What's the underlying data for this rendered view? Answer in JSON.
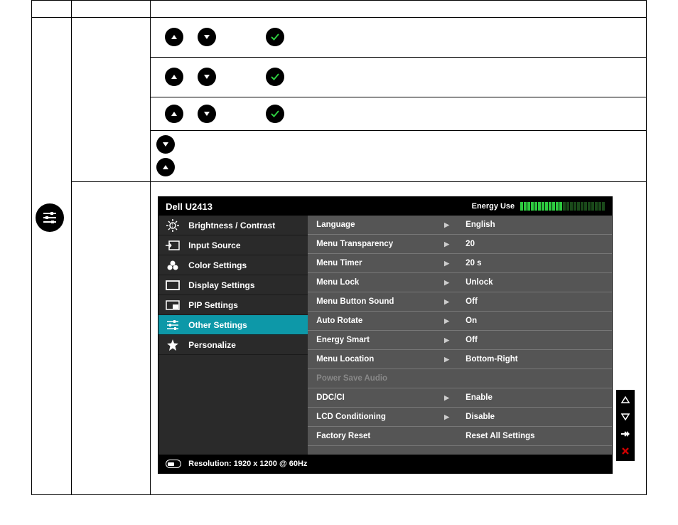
{
  "osd": {
    "title": "Dell U2413",
    "energy_label": "Energy Use",
    "energy_bars_total": 24,
    "energy_bars_on": 12,
    "menu": [
      {
        "icon": "brightness",
        "label": "Brightness / Contrast"
      },
      {
        "icon": "input",
        "label": "Input Source"
      },
      {
        "icon": "color",
        "label": "Color Settings"
      },
      {
        "icon": "display",
        "label": "Display Settings"
      },
      {
        "icon": "pip",
        "label": "PIP Settings"
      },
      {
        "icon": "other",
        "label": "Other Settings",
        "active": true
      },
      {
        "icon": "star",
        "label": "Personalize"
      }
    ],
    "settings": [
      {
        "name": "Language",
        "value": "English",
        "arrow": true
      },
      {
        "name": "Menu Transparency",
        "value": "20",
        "arrow": true
      },
      {
        "name": "Menu Timer",
        "value": "20 s",
        "arrow": true
      },
      {
        "name": "Menu Lock",
        "value": "Unlock",
        "arrow": true
      },
      {
        "name": "Menu Button Sound",
        "value": "Off",
        "arrow": true
      },
      {
        "name": "Auto Rotate",
        "value": "On",
        "arrow": true
      },
      {
        "name": "Energy Smart",
        "value": "Off",
        "arrow": true
      },
      {
        "name": "Menu Location",
        "value": "Bottom-Right",
        "arrow": true
      },
      {
        "name": "Power Save Audio",
        "value": "",
        "arrow": false,
        "disabled": true
      },
      {
        "name": "DDC/CI",
        "value": "Enable",
        "arrow": true
      },
      {
        "name": "LCD Conditioning",
        "value": "Disable",
        "arrow": true
      },
      {
        "name": "Factory Reset",
        "value": "Reset All Settings",
        "arrow": false
      }
    ],
    "footer": "Resolution: 1920 x 1200 @ 60Hz"
  },
  "button_icons": {
    "up": "▲",
    "down": "▼",
    "check": "✓",
    "right": "→",
    "close": "✕"
  }
}
